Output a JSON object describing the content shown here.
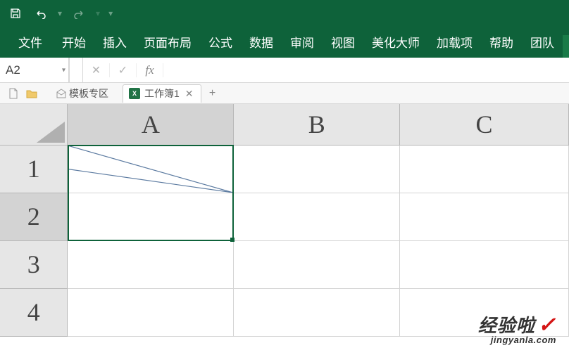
{
  "titlebar": {
    "save_icon": "save",
    "undo_icon": "undo",
    "redo_icon": "redo"
  },
  "ribbon": {
    "tabs": [
      "文件",
      "开始",
      "插入",
      "页面布局",
      "公式",
      "数据",
      "审阅",
      "视图",
      "美化大师",
      "加载项",
      "帮助",
      "团队"
    ]
  },
  "namebox": {
    "value": "A2"
  },
  "fn": {
    "dropdown": "▾",
    "cancel": "✕",
    "confirm": "✓",
    "fx": "fx"
  },
  "formula": {
    "value": ""
  },
  "sheettabs": {
    "template_zone": "模板专区",
    "workbook": "工作簿1",
    "close": "✕",
    "plus": "+"
  },
  "grid": {
    "cols": [
      "A",
      "B",
      "C"
    ],
    "rows": [
      "1",
      "2",
      "3",
      "4"
    ],
    "selected_cell": "A2"
  },
  "watermark": {
    "line1": "经验啦",
    "check": "✓",
    "line2": "jingyanla.com"
  }
}
